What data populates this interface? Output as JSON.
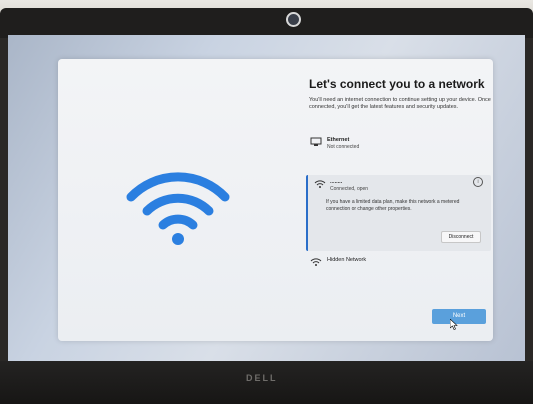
{
  "device": {
    "brand": "DELL"
  },
  "oobe": {
    "title": "Let's connect you to a network",
    "description": "You'll need an internet connection to continue setting up your device. Once connected, you'll get the latest features and security updates.",
    "networks": {
      "ethernet": {
        "name": "Ethernet",
        "status": "Not connected",
        "icon": "ethernet-icon"
      },
      "wifi": {
        "name": "........",
        "status": "Connected, open",
        "icon": "wifi-icon",
        "info_icon": "info-icon",
        "details": "If you have a limited data plan, make this network a metered connection or change other properties.",
        "disconnect_label": "Disconnect"
      },
      "hidden": {
        "name": "Hidden Network",
        "icon": "wifi-icon"
      }
    },
    "next_label": "Next"
  },
  "colors": {
    "accent": "#2a6ec9",
    "next_button": "#5aa0dc",
    "hero_wifi": "#2b7fe0"
  }
}
